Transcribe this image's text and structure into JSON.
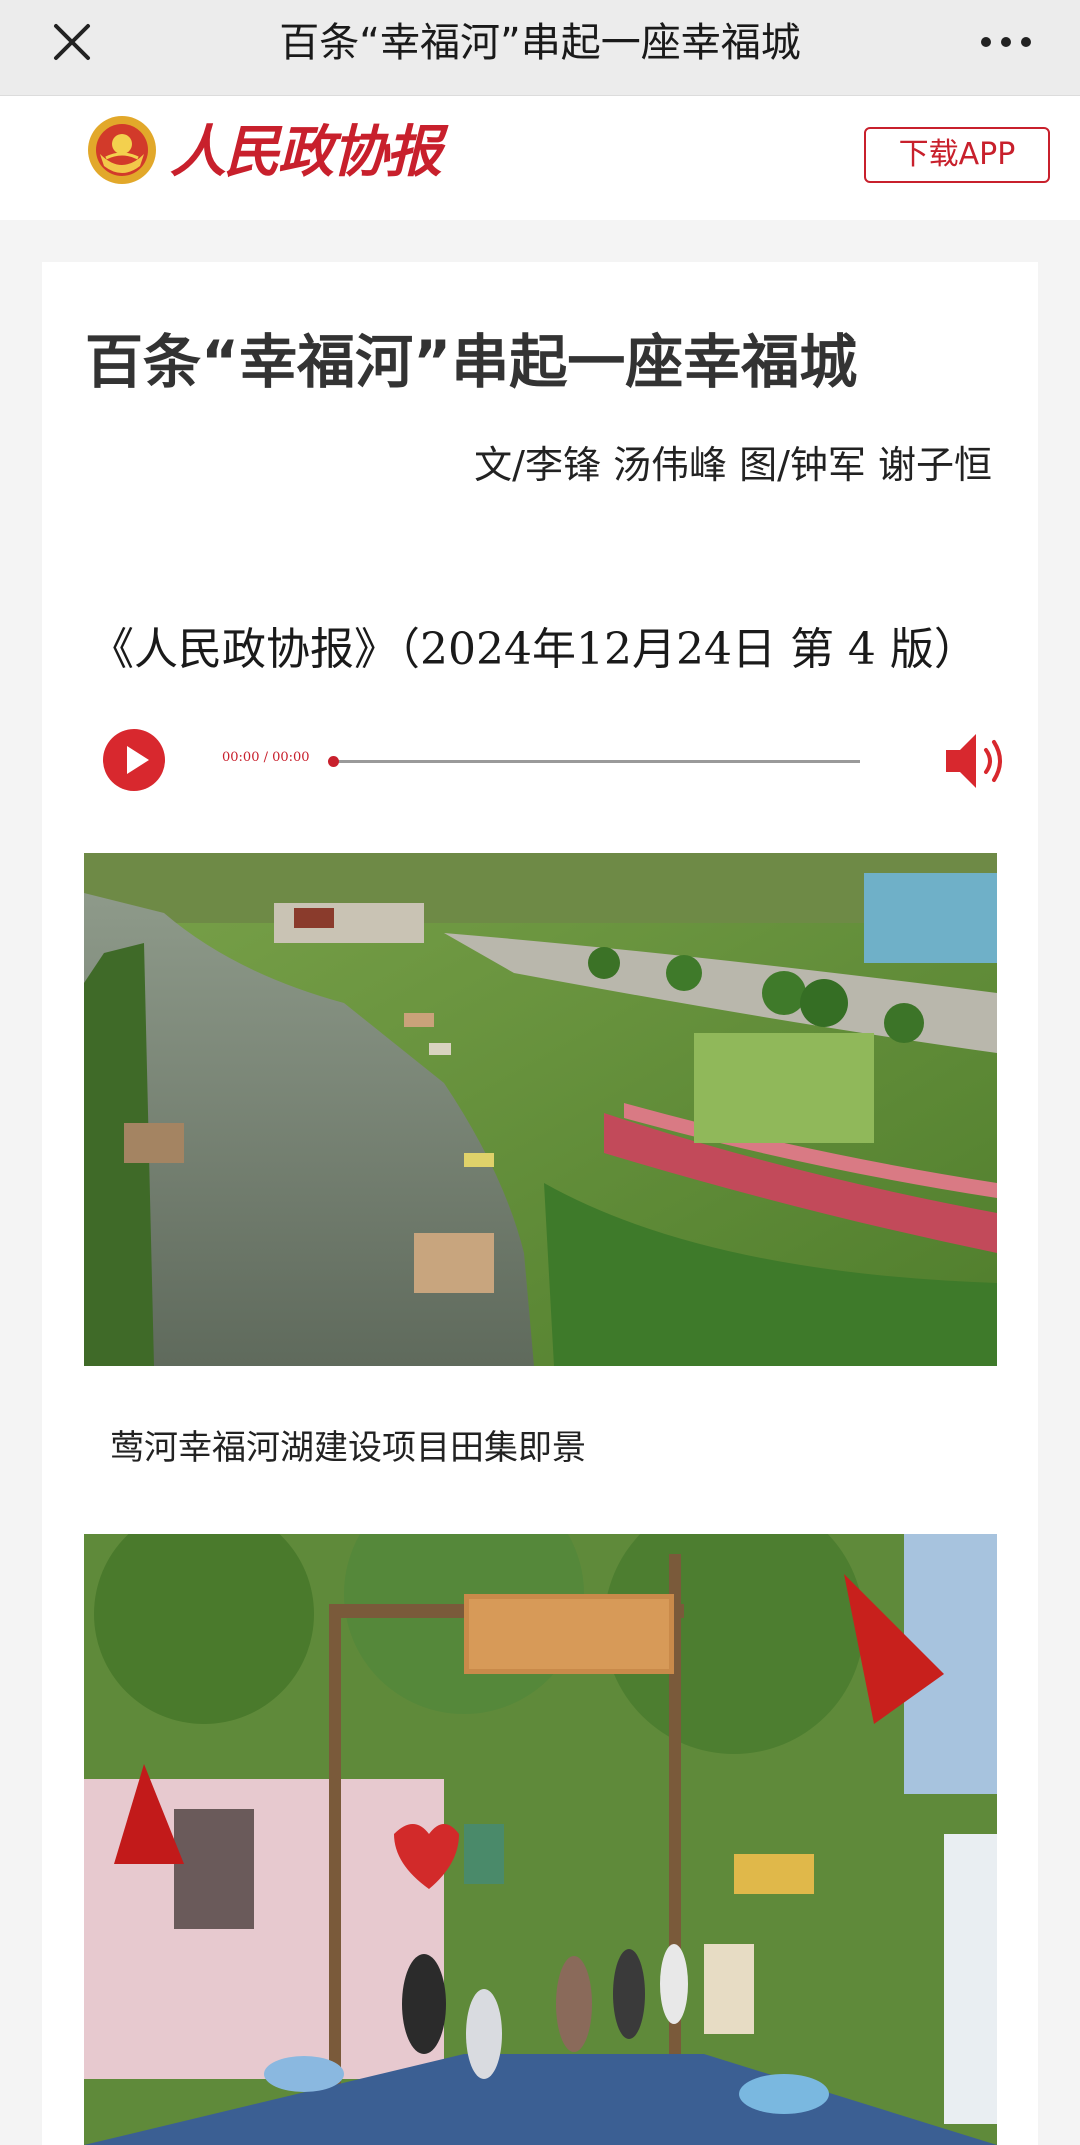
{
  "navbar": {
    "title": "百条“幸福河”串起一座幸福城",
    "close_icon": "close-icon",
    "more_icon": "more-options-icon"
  },
  "brand": {
    "name": "人民政协报",
    "emblem_icon": "cppcc-emblem-icon",
    "download_label": "下载APP",
    "color": "#c8202c"
  },
  "article": {
    "headline": "百条“幸福河”串起一座幸福城",
    "byline": "文/李锋 汤伟峰 图/钟军 谢子恒",
    "edition": "《人民政协报》（2024年12月24日 第 4 版）",
    "audio": {
      "time": "00:00 / 00:00",
      "progress": 0,
      "play_icon": "play-icon",
      "volume_icon": "volume-icon"
    },
    "photo1_caption": "莺河幸福河湖建设项目田集即景"
  }
}
